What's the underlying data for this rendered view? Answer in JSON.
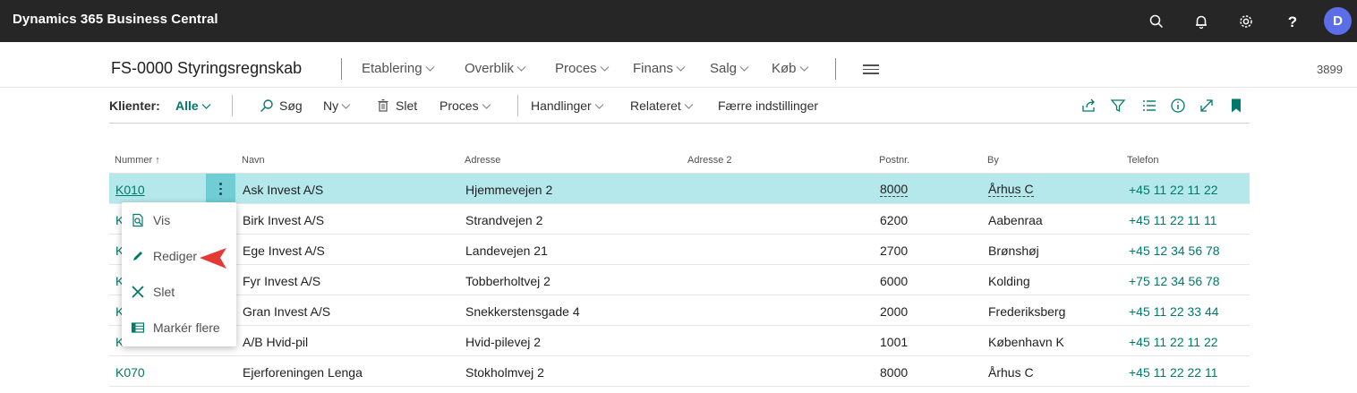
{
  "app": {
    "title": "Dynamics 365 Business Central",
    "avatar_initial": "D"
  },
  "icons": {
    "search": "search-icon",
    "bell": "bell-icon",
    "gear": "gear-icon",
    "help": "help-icon"
  },
  "header": {
    "title": "FS-0000 Styringsregnskab",
    "nav": [
      "Etablering",
      "Overblik",
      "Proces",
      "Finans",
      "Salg",
      "Køb"
    ],
    "company_no": "3899"
  },
  "actionbar": {
    "filter_label": "Klienter:",
    "filter_value": "Alle",
    "search": "Søg",
    "new": "Ny",
    "delete": "Slet",
    "process": "Proces",
    "actions": "Handlinger",
    "related": "Relateret",
    "fewer": "Færre indstillinger"
  },
  "table": {
    "columns": [
      "Nummer",
      "Navn",
      "Adresse",
      "Adresse 2",
      "Postnr.",
      "By",
      "Telefon"
    ],
    "sort_indicator": "↑",
    "rows": [
      {
        "nummer": "K010",
        "navn": "Ask Invest A/S",
        "adresse": "Hjemmevejen 2",
        "adresse2": "",
        "postnr": "8000",
        "by": "Århus C",
        "telefon": "+45 11 22 11 22"
      },
      {
        "nummer": "K",
        "navn": "Birk Invest A/S",
        "adresse": "Strandvejen 2",
        "adresse2": "",
        "postnr": "6200",
        "by": "Aabenraa",
        "telefon": "+45 11 22 11 11"
      },
      {
        "nummer": "K",
        "navn": "Ege Invest A/S",
        "adresse": "Landevejen 21",
        "adresse2": "",
        "postnr": "2700",
        "by": "Brønshøj",
        "telefon": "+45 12 34 56 78"
      },
      {
        "nummer": "K",
        "navn": "Fyr Invest A/S",
        "adresse": "Tobberholtvej 2",
        "adresse2": "",
        "postnr": "6000",
        "by": "Kolding",
        "telefon": "+75 12 34 56 78"
      },
      {
        "nummer": "K",
        "navn": "Gran Invest A/S",
        "adresse": "Snekkerstensgade 4",
        "adresse2": "",
        "postnr": "2000",
        "by": "Frederiksberg",
        "telefon": "+45 11 22 33 44"
      },
      {
        "nummer": "K",
        "navn": "A/B Hvid-pil",
        "adresse": "Hvid-pilevej 2",
        "adresse2": "",
        "postnr": "1001",
        "by": "København K",
        "telefon": "+45 11 22 11 22"
      },
      {
        "nummer": "K070",
        "navn": "Ejerforeningen Lenga",
        "adresse": "Stokholmvej 2",
        "adresse2": "",
        "postnr": "8000",
        "by": "Århus C",
        "telefon": "+45 11 22 22 11"
      }
    ]
  },
  "context_menu": [
    "Vis",
    "Rediger",
    "Slet",
    "Markér flere"
  ],
  "colors": {
    "accent": "#00796b",
    "selected_row": "#b4e8ea",
    "kebab": "#6fcdd3",
    "appbar": "#262626",
    "avatar": "#5b6ee8",
    "callout": "#e53935"
  }
}
